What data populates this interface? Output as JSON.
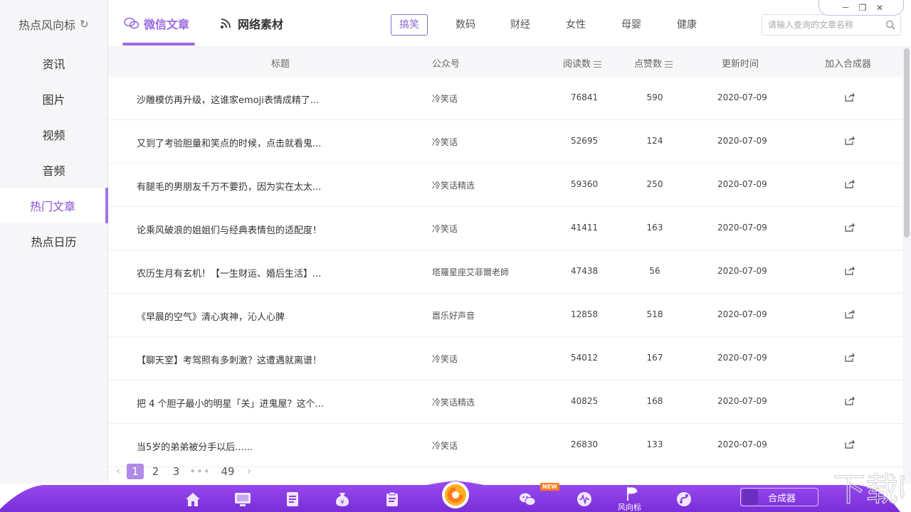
{
  "window": {
    "brand": "热点风向标",
    "controls": {
      "minimize": "－",
      "restore": "❐",
      "close": "✕"
    }
  },
  "sidebar": {
    "items": [
      {
        "label": "资讯"
      },
      {
        "label": "图片"
      },
      {
        "label": "视频"
      },
      {
        "label": "音频"
      },
      {
        "label": "热门文章",
        "active": true
      },
      {
        "label": "热点日历"
      }
    ]
  },
  "tabs": {
    "main": [
      {
        "label": "微信文章",
        "active": true
      },
      {
        "label": "网络素材"
      }
    ],
    "categories": [
      "搞笑",
      "数码",
      "财经",
      "女性",
      "母婴",
      "健康"
    ],
    "active_category": "搞笑"
  },
  "search": {
    "placeholder": "请输入查询的文章名称"
  },
  "table": {
    "headers": {
      "title": "标题",
      "account": "公众号",
      "reads": "阅读数",
      "likes": "点赞数",
      "updated": "更新时间",
      "add": "加入合成器"
    },
    "rows": [
      {
        "title": "沙雕模仿再升级，这谁家emoji表情成精了...",
        "account": "冷笑话",
        "reads": "76841",
        "likes": "590",
        "date": "2020-07-09"
      },
      {
        "title": "又到了考验胆量和笑点的时候，点击就看鬼...",
        "account": "冷笑话",
        "reads": "52695",
        "likes": "124",
        "date": "2020-07-09"
      },
      {
        "title": "有腿毛的男朋友千万不要扔，因为实在太太...",
        "account": "冷笑话精选",
        "reads": "59360",
        "likes": "250",
        "date": "2020-07-09"
      },
      {
        "title": "论乘风破浪的姐姐们与经典表情包的适配度！",
        "account": "冷笑话",
        "reads": "41411",
        "likes": "163",
        "date": "2020-07-09"
      },
      {
        "title": "农历生月有玄机！【一生财运、婚后生活】...",
        "account": "塔羅星座艾菲爾老師",
        "reads": "47438",
        "likes": "56",
        "date": "2020-07-09"
      },
      {
        "title": "《早晨的空气》清心爽神，沁人心脾",
        "account": "嚣乐好声音",
        "reads": "12858",
        "likes": "518",
        "date": "2020-07-09"
      },
      {
        "title": "【聊天室】考驾照有多刺激？这遭遇就离谱！",
        "account": "冷笑话",
        "reads": "54012",
        "likes": "167",
        "date": "2020-07-09"
      },
      {
        "title": "把 4 个胆子最小的明星「关」进鬼屋？这个...",
        "account": "冷笑话精选",
        "reads": "40825",
        "likes": "168",
        "date": "2020-07-09"
      },
      {
        "title": "当5岁的弟弟被分手以后......",
        "account": "冷笑话",
        "reads": "26830",
        "likes": "133",
        "date": "2020-07-09"
      }
    ]
  },
  "pagination": {
    "prev": "‹",
    "pages": [
      "1",
      "2",
      "3"
    ],
    "ellipsis": "•••",
    "last": "49",
    "next": "›",
    "current": "1"
  },
  "dock": {
    "new_badge": "NEW",
    "trend_label": "风向标",
    "composer_label": "合成器",
    "icons": [
      "home-icon",
      "monitor-icon",
      "document-icon",
      "money-bag-icon",
      "clipboard-icon",
      "wechat-icon",
      "audio-wave-icon",
      "trend-flag-icon",
      "mini-program-icon"
    ]
  },
  "colors": {
    "accent": "#9b6ae0",
    "dock": "#8a3fe0",
    "badge": "#ff7a1a"
  }
}
